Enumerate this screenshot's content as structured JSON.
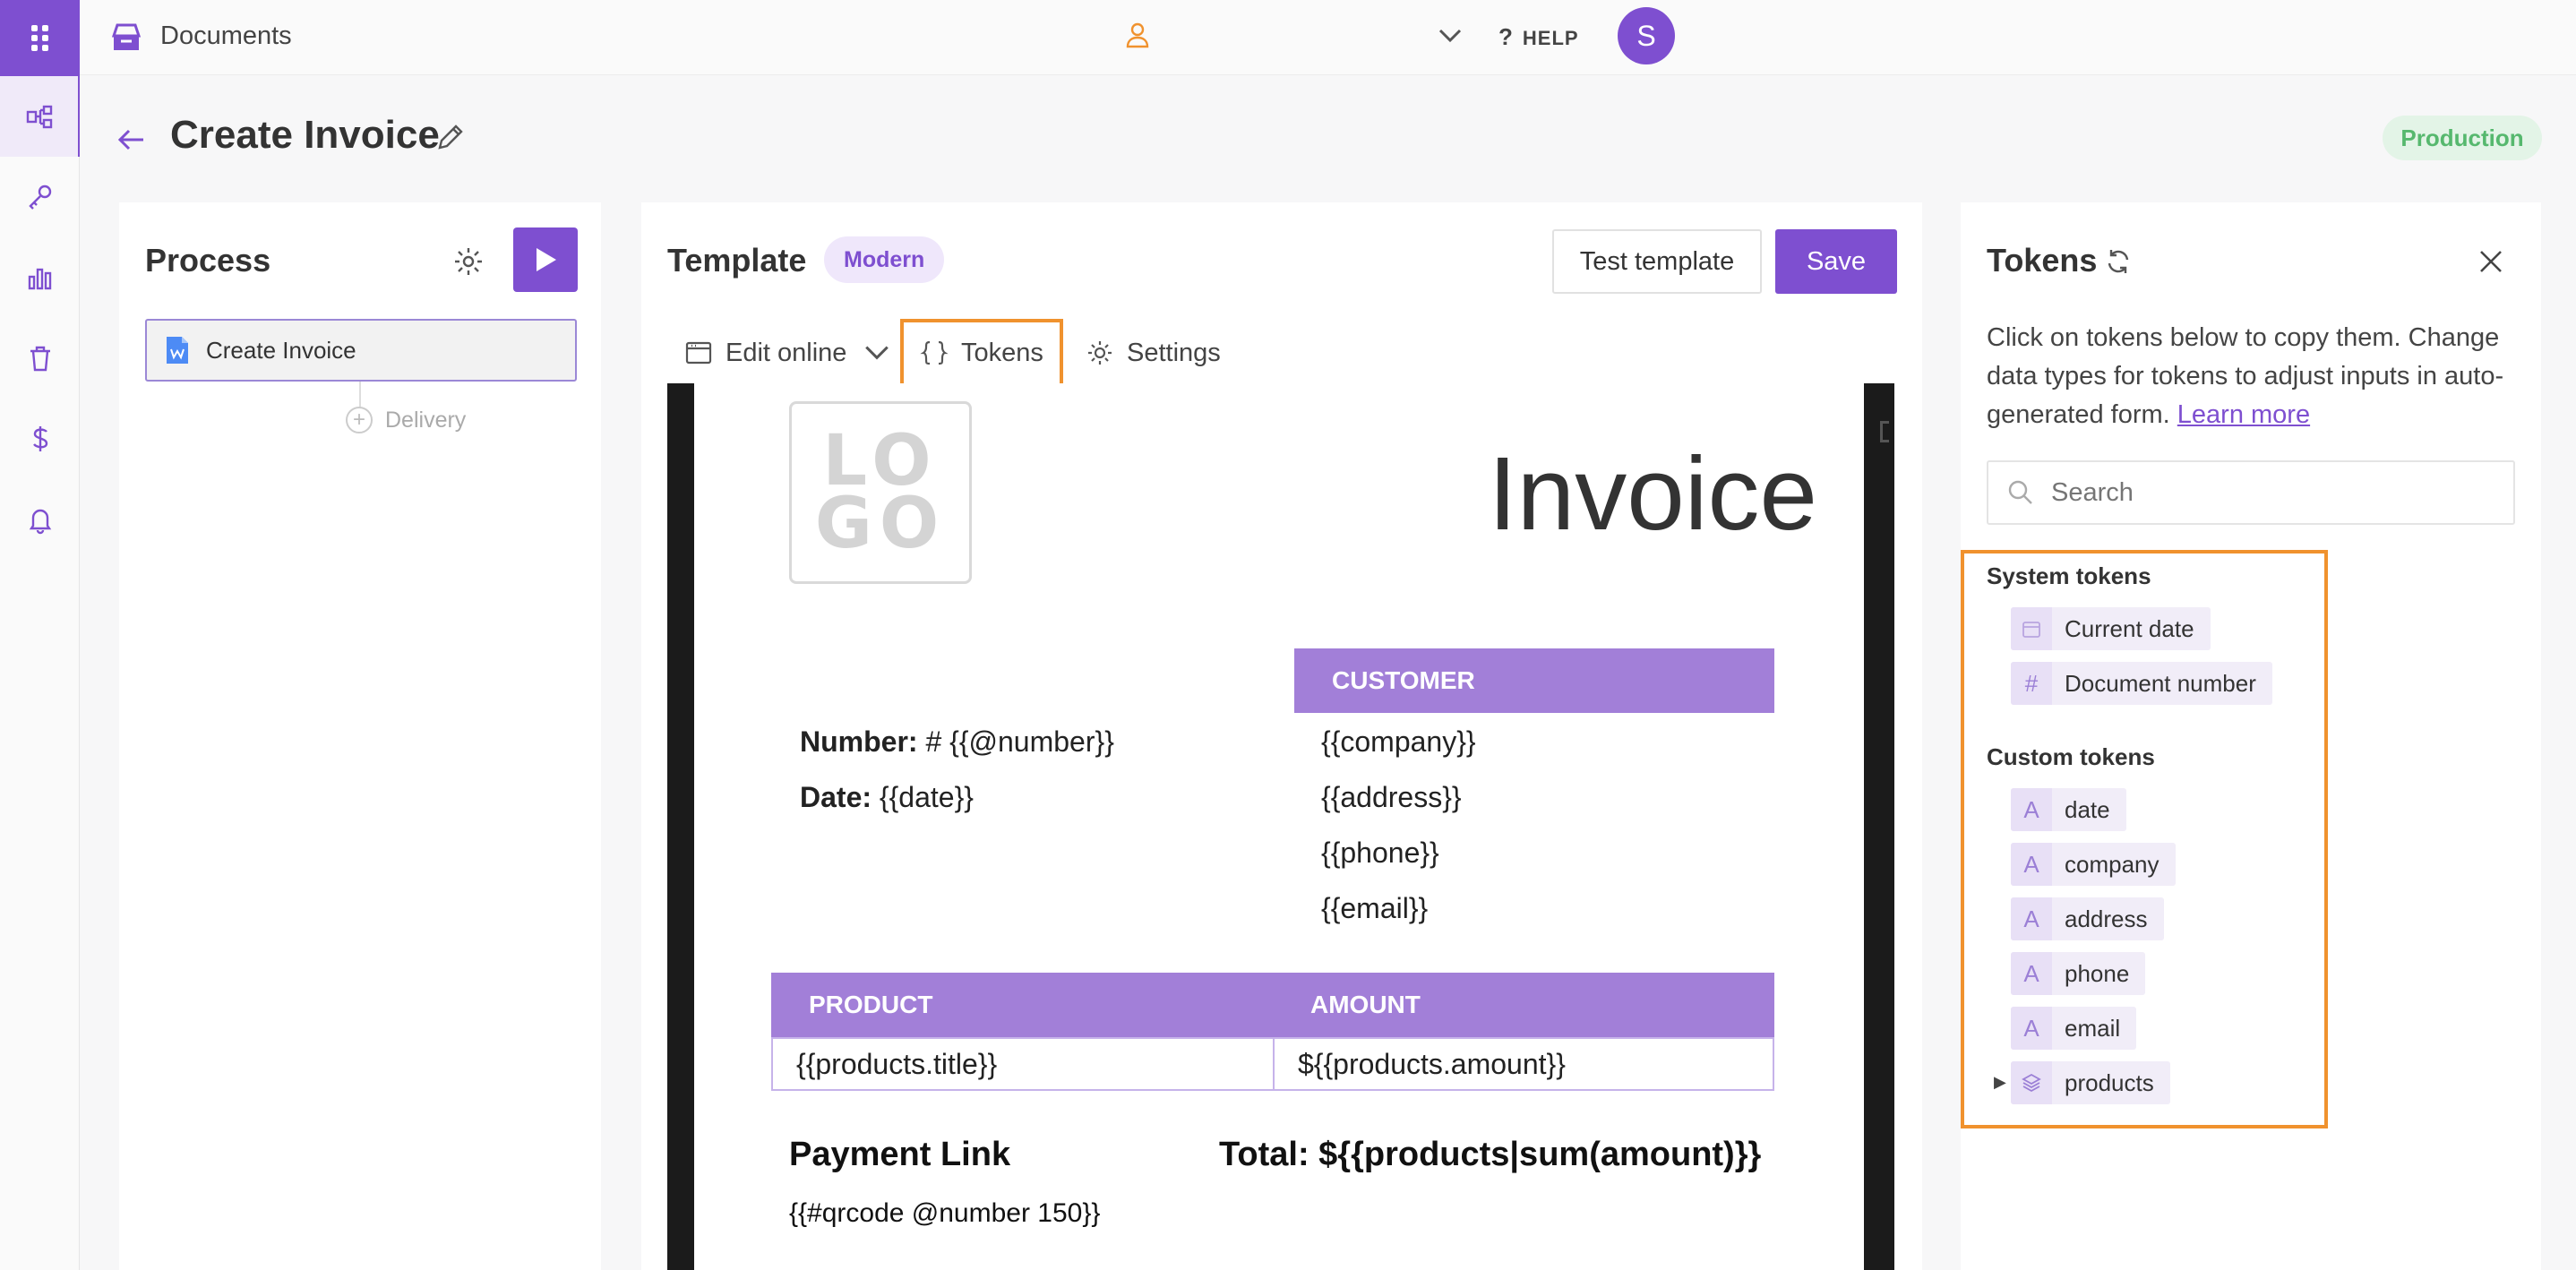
{
  "topbar": {
    "app_title": "Documents",
    "help_label": "HELP",
    "avatar_initial": "S"
  },
  "page": {
    "title": "Create Invoice",
    "environment": "Production"
  },
  "process": {
    "title": "Process",
    "step_label": "Create Invoice",
    "delivery_label": "Delivery"
  },
  "template": {
    "title": "Template",
    "style_badge": "Modern",
    "test_button": "Test template",
    "save_button": "Save",
    "tabs": {
      "edit_online": "Edit online",
      "tokens": "Tokens",
      "settings": "Settings"
    }
  },
  "document": {
    "logo_text_top": "LO",
    "logo_text_bottom": "GO",
    "heading": "Invoice",
    "customer_header": "CUSTOMER",
    "number_label": "Number:",
    "number_value": "# {{@number}}",
    "date_label": "Date:",
    "date_value": "{{date}}",
    "customer_lines": [
      "{{company}}",
      "{{address}}",
      "{{phone}}",
      "{{email}}"
    ],
    "product_header": "PRODUCT",
    "amount_header": "AMOUNT",
    "product_row": {
      "title": "{{products.title}}",
      "amount": "${{products.amount}}"
    },
    "payment_title": "Payment Link",
    "payment_code": "{{#qrcode @number 150}}",
    "total": "Total: ${{products|sum(amount)}}"
  },
  "tokens": {
    "title": "Tokens",
    "description": "Click on tokens below to copy them. Change data types for tokens to adjust inputs in auto-generated form.",
    "learn_more": "Learn more",
    "search_placeholder": "Search",
    "system_title": "System tokens",
    "system": [
      {
        "label": "Current date",
        "icon": "calendar-icon"
      },
      {
        "label": "Document number",
        "icon": "hash-icon"
      }
    ],
    "custom_title": "Custom tokens",
    "custom": [
      {
        "label": "date",
        "icon": "text-type-icon"
      },
      {
        "label": "company",
        "icon": "text-type-icon"
      },
      {
        "label": "address",
        "icon": "text-type-icon"
      },
      {
        "label": "phone",
        "icon": "text-type-icon"
      },
      {
        "label": "email",
        "icon": "text-type-icon"
      },
      {
        "label": "products",
        "icon": "layers-icon"
      }
    ]
  },
  "colors": {
    "accent": "#7e4fd0",
    "table_header": "#a27fd8",
    "highlight": "#f0922e",
    "production_text": "#56b86e"
  }
}
